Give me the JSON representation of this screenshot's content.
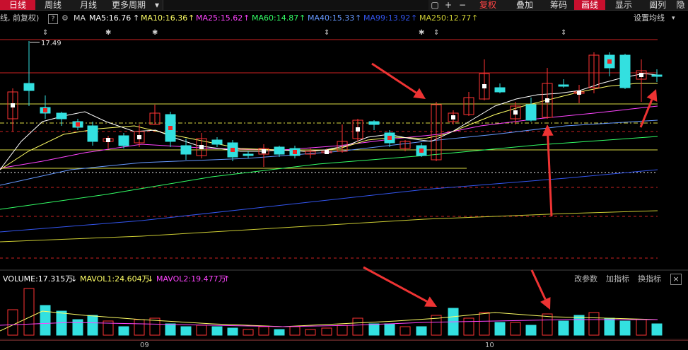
{
  "topbar": {
    "tabs": [
      "日线",
      "周线",
      "月线",
      "更多周期"
    ],
    "dropdown_arrow": "▾",
    "right_buttons": [
      "复权",
      "叠加",
      "筹码",
      "画线",
      "显示",
      "阖列",
      "隐"
    ],
    "icons": [
      "square-icon",
      "plus-icon",
      "minus-icon"
    ]
  },
  "ma_bar": {
    "prefix": "线, 前复权)",
    "help_icon": "?",
    "gear_icon": "⚙",
    "ma_label": "MA",
    "items": [
      {
        "text": "MA5:16.76",
        "arrow": "↑",
        "color": "#ffffff"
      },
      {
        "text": "MA10:16.36",
        "arrow": "↑",
        "color": "#ffff66"
      },
      {
        "text": "MA25:15.62",
        "arrow": "↑",
        "color": "#ff44ff"
      },
      {
        "text": "MA60:14.87",
        "arrow": "↑",
        "color": "#33ff66"
      },
      {
        "text": "MA40:15.33",
        "arrow": "↑",
        "color": "#6699ff"
      },
      {
        "text": "MA99:13.92",
        "arrow": "↑",
        "color": "#3355ee"
      },
      {
        "text": "MA250:12.77",
        "arrow": "↑",
        "color": "#cccc33"
      }
    ],
    "settings": "设置均线"
  },
  "price_panel": {
    "high_label": "17.49"
  },
  "volume_bar": {
    "volume": "VOLUME:17.315万",
    "mavol1": "MAVOL1:24.604万",
    "mavol2": "MAVOL2:19.477万",
    "arrow_down": "↓",
    "arrow_up": "↑",
    "buttons": [
      "改参数",
      "加指标",
      "换指标"
    ],
    "close": "×"
  },
  "x_axis": {
    "labels": [
      "09",
      "10"
    ]
  },
  "colors": {
    "up": "#ff3333",
    "down": "#33e0e0",
    "ma5": "#ffffff",
    "ma10": "#ffff66",
    "ma25": "#ff44ff",
    "ma40": "#6699ff",
    "ma60": "#33ff66",
    "ma99": "#3355ee",
    "ma250": "#cccc33",
    "annotation_arrow": "#ee3333"
  }
}
